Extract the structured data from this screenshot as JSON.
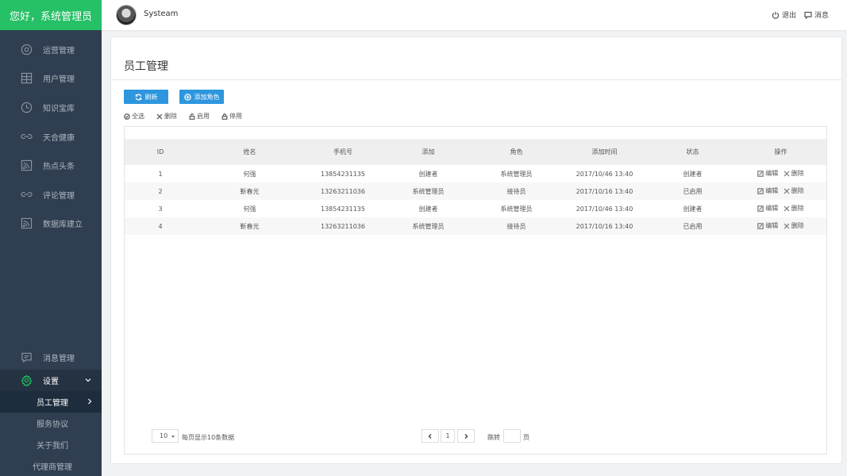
{
  "brand": {
    "greeting": "您好，系统管理员"
  },
  "header": {
    "username": "Systeam",
    "logout_label": "退出",
    "messages_label": "消息"
  },
  "sidebar": {
    "items": [
      {
        "label": "运营管理",
        "icon": "target-icon"
      },
      {
        "label": "用户管理",
        "icon": "grid-icon"
      },
      {
        "label": "知识宝库",
        "icon": "clock-icon"
      },
      {
        "label": "天合健康",
        "icon": "link-icon"
      },
      {
        "label": "热点头条",
        "icon": "rss-icon"
      },
      {
        "label": "评论管理",
        "icon": "link-icon"
      },
      {
        "label": "数据库建立",
        "icon": "rss-icon"
      }
    ],
    "message_mgmt": "消息管理",
    "settings": {
      "label": "设置",
      "sub_items": [
        "员工管理",
        "服务协议",
        "关于我们",
        "代理商管理"
      ]
    }
  },
  "page": {
    "title": "员工管理",
    "refresh_button": "刷新",
    "add_role_button": "添加角色",
    "tools": {
      "select_all": "全选",
      "delete": "删除",
      "enable": "启用",
      "disable": "停用"
    }
  },
  "table": {
    "headers": [
      "ID",
      "姓名",
      "手机号",
      "添加",
      "角色",
      "添加时间",
      "状态",
      "操作"
    ],
    "rows": [
      [
        "1",
        "何强",
        "13854231135",
        "创建者",
        "系统管理员",
        "2017/10/46 13:40",
        "创建者"
      ],
      [
        "2",
        "靳春光",
        "13263211036",
        "系统管理员",
        "接待员",
        "2017/10/16 13:40",
        "已启用"
      ],
      [
        "3",
        "何强",
        "13854231135",
        "创建者",
        "系统管理员",
        "2017/10/46 13:40",
        "创建者"
      ],
      [
        "4",
        "靳春光",
        "13263211036",
        "系统管理员",
        "接待员",
        "2017/10/16 13:40",
        "已启用"
      ]
    ],
    "edit_label": "编辑",
    "delete_label": "删除"
  },
  "pagination": {
    "page_size": "10",
    "page_size_info": "每页显示10条数据",
    "current_page": "1",
    "jump_label": "跳转",
    "page_unit": "页"
  },
  "colors": {
    "brand_green": "#26c066",
    "sidebar_bg": "#2f3e50",
    "primary_blue": "#2d96de"
  }
}
